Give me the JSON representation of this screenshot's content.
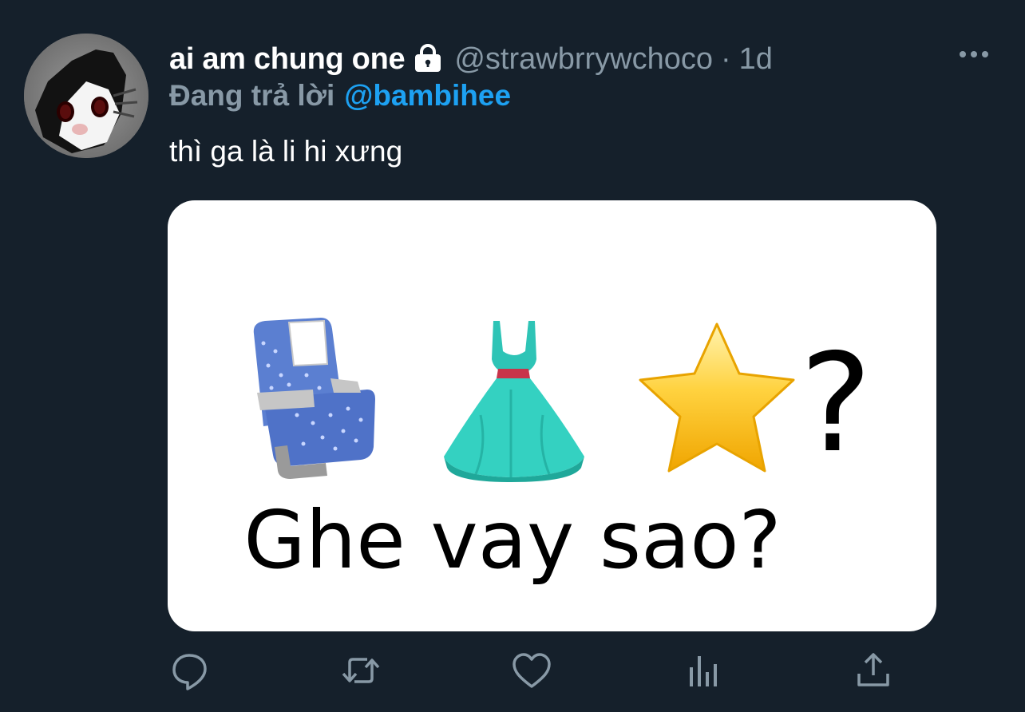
{
  "tweet": {
    "display_name": "ai am chung one",
    "handle": "@strawbrrywchoco",
    "separator": "·",
    "time": "1d",
    "reply_prefix": "Đang trả lời",
    "reply_to": "@bambihee",
    "text": "thì ga là li hi xưng",
    "protected_icon": "lock-icon",
    "more_icon": "more-horizontal-icon"
  },
  "media": {
    "emojis": [
      "seat",
      "dress",
      "star"
    ],
    "question_mark": "?",
    "caption": "Ghe vay sao?"
  },
  "actions": {
    "icons": [
      "reply-icon",
      "retweet-icon",
      "like-icon",
      "analytics-icon",
      "share-icon"
    ]
  },
  "colors": {
    "background": "#15202b",
    "secondary_text": "#8899a6",
    "accent": "#1da1f2"
  }
}
